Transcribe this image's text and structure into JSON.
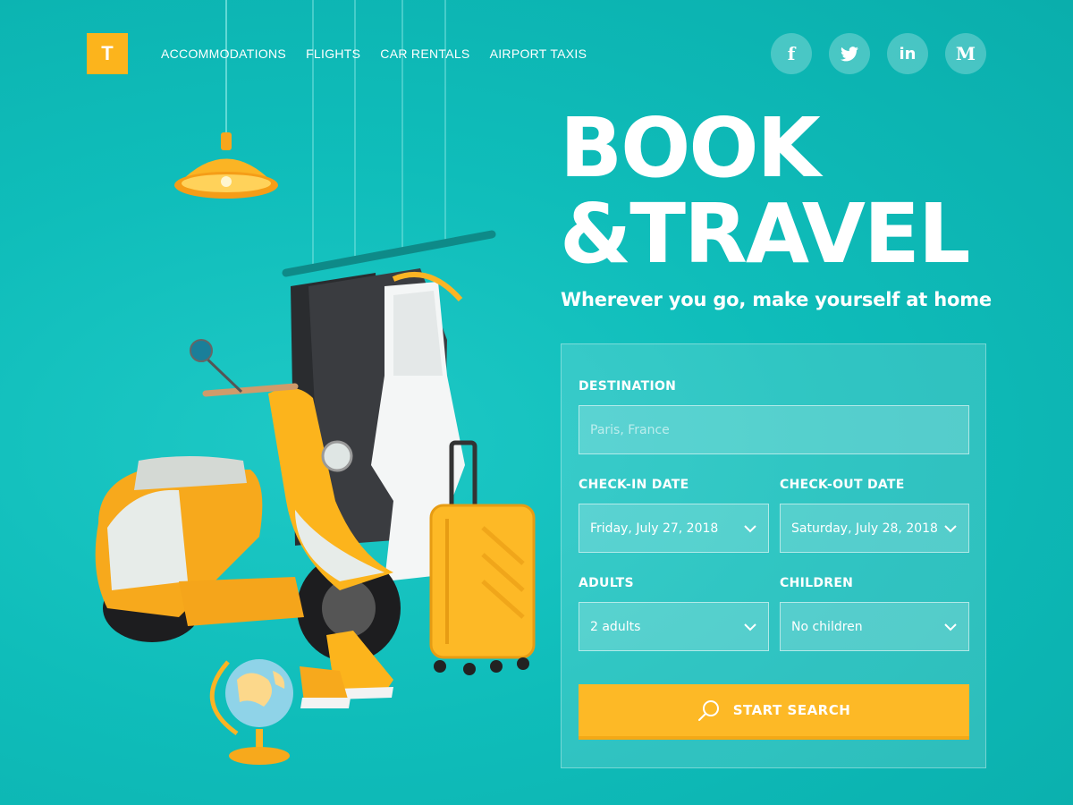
{
  "brand": {
    "logo_letter": "T",
    "accent": "#fcb41c",
    "background": "#0fbdba"
  },
  "nav": {
    "items": [
      {
        "label": "ACCOMMODATIONS"
      },
      {
        "label": "FLIGHTS"
      },
      {
        "label": "CAR RENTALS"
      },
      {
        "label": "AIRPORT TAXIS"
      }
    ]
  },
  "social": {
    "facebook": "f",
    "twitter": "twitter-icon",
    "linkedin": "in",
    "medium": "M"
  },
  "hero": {
    "title_line1": "BOOK",
    "title_line2": "&TRAVEL",
    "subtitle": "Wherever you go, make yourself at home"
  },
  "form": {
    "destination": {
      "label": "DESTINATION",
      "placeholder": "Paris, France",
      "value": ""
    },
    "checkin": {
      "label": "CHECK-IN DATE",
      "value": "Friday, July 27, 2018"
    },
    "checkout": {
      "label": "CHECK-OUT DATE",
      "value": "Saturday, July 28, 2018"
    },
    "adults": {
      "label": "ADULTS",
      "value": "2 adults"
    },
    "children": {
      "label": "CHILDREN",
      "value": "No children"
    },
    "search_button": "START SEARCH"
  }
}
